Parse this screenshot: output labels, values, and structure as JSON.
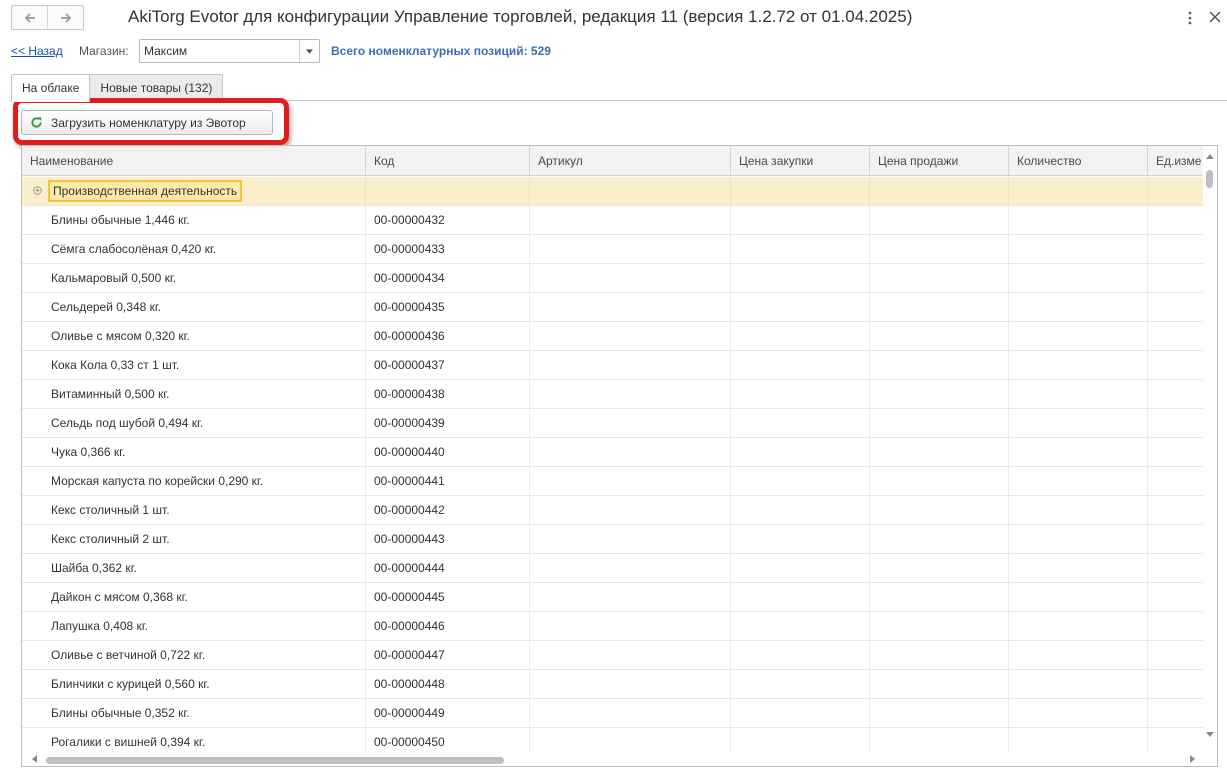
{
  "window": {
    "title": "AkiTorg Evotor для конфигурации Управление торговлей, редакция 11 (версия 1.2.72 от 01.04.2025)",
    "icons": {
      "back": "arrow-left-icon",
      "forward": "arrow-right-icon",
      "more": "more-vertical-icon",
      "close": "close-icon"
    }
  },
  "toolbar": {
    "back_link": "<< Назад",
    "store_label": "Магазин:",
    "store_value": "Максим",
    "total_label": "Всего номенклатурных позиций: 529"
  },
  "tabs": [
    {
      "label": "На облаке",
      "active": true
    },
    {
      "label": "Новые товары (132)",
      "active": false
    }
  ],
  "actions": {
    "load_button": "Загрузить номенклатуру из Эвотор",
    "load_icon": "refresh-icon",
    "highlight_color": "#e31b1b"
  },
  "table": {
    "columns": [
      "Наименование",
      "Код",
      "Артикул",
      "Цена закупки",
      "Цена продажи",
      "Количество",
      "Ед.изме"
    ],
    "group": {
      "name": "Производственная деятельность",
      "icon": "expand-plus-icon"
    },
    "rows": [
      {
        "name": "Блины обычные 1,446 кг.",
        "code": "00-00000432"
      },
      {
        "name": "Сёмга слабосолёная 0,420 кг.",
        "code": "00-00000433"
      },
      {
        "name": "Кальмаровый 0,500 кг.",
        "code": "00-00000434"
      },
      {
        "name": "Сельдерей 0,348 кг.",
        "code": "00-00000435"
      },
      {
        "name": "Оливье с мясом 0,320 кг.",
        "code": "00-00000436"
      },
      {
        "name": "Кока Кола 0,33 ст 1 шт.",
        "code": "00-00000437"
      },
      {
        "name": "Витаминный 0,500 кг.",
        "code": "00-00000438"
      },
      {
        "name": "Сельдь под шубой 0,494 кг.",
        "code": "00-00000439"
      },
      {
        "name": "Чука 0,366 кг.",
        "code": "00-00000440"
      },
      {
        "name": "Морская капуста по корейски 0,290 кг.",
        "code": "00-00000441"
      },
      {
        "name": "Кекс столичный 1 шт.",
        "code": "00-00000442"
      },
      {
        "name": "Кекс столичный 2 шт.",
        "code": "00-00000443"
      },
      {
        "name": "Шайба 0,362 кг.",
        "code": "00-00000444"
      },
      {
        "name": "Дайкон с мясом 0,368 кг.",
        "code": "00-00000445"
      },
      {
        "name": "Лапушка 0,408 кг.",
        "code": "00-00000446"
      },
      {
        "name": "Оливье с ветчиной 0,722 кг.",
        "code": "00-00000447"
      },
      {
        "name": "Блинчики с курицей 0,560 кг.",
        "code": "00-00000448"
      },
      {
        "name": "Блины обычные 0,352 кг.",
        "code": "00-00000449"
      },
      {
        "name": "Рогалики  с вишней 0,394 кг.",
        "code": "00-00000450"
      }
    ]
  }
}
